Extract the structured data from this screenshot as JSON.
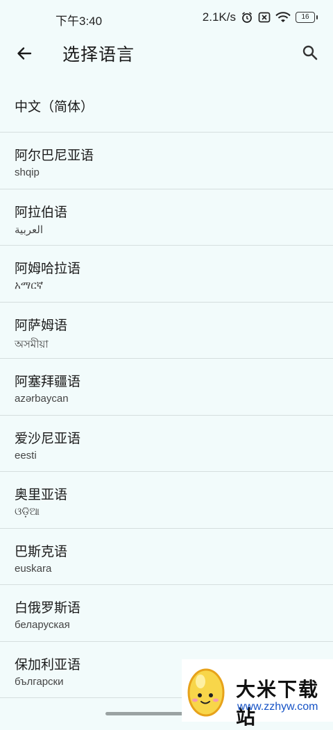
{
  "status_bar": {
    "time": "下午3:40",
    "net_speed": "2.1K/s",
    "battery": "16"
  },
  "app_bar": {
    "title": "选择语言"
  },
  "languages": [
    {
      "name": "中文（简体）",
      "native": ""
    },
    {
      "name": "阿尔巴尼亚语",
      "native": "shqip"
    },
    {
      "name": "阿拉伯语",
      "native": "العربية"
    },
    {
      "name": "阿姆哈拉语",
      "native": "አማርኛ"
    },
    {
      "name": "阿萨姆语",
      "native": "অসমীয়া"
    },
    {
      "name": "阿塞拜疆语",
      "native": "azərbaycan"
    },
    {
      "name": "爱沙尼亚语",
      "native": "eesti"
    },
    {
      "name": "奥里亚语",
      "native": "ଓଡ଼ିଆ"
    },
    {
      "name": "巴斯克语",
      "native": "euskara"
    },
    {
      "name": "白俄罗斯语",
      "native": "беларуская"
    },
    {
      "name": "保加利亚语",
      "native": "български"
    }
  ],
  "watermark": {
    "title": "大米下载站",
    "url": "www.zzhyw.com"
  }
}
